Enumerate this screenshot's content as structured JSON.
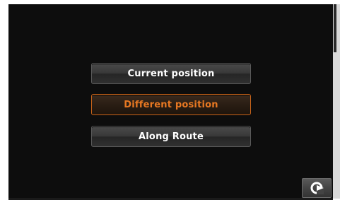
{
  "menu": {
    "items": [
      {
        "label": "Current position",
        "selected": false
      },
      {
        "label": "Different position",
        "selected": true
      },
      {
        "label": "Along Route",
        "selected": false
      }
    ]
  },
  "toolbar": {
    "back_icon": "back-arrow-icon"
  },
  "colors": {
    "screen_bg": "#0d0d0d",
    "button_text": "#ffffff",
    "selected_text": "#e87822",
    "selected_border": "#c8641a"
  }
}
